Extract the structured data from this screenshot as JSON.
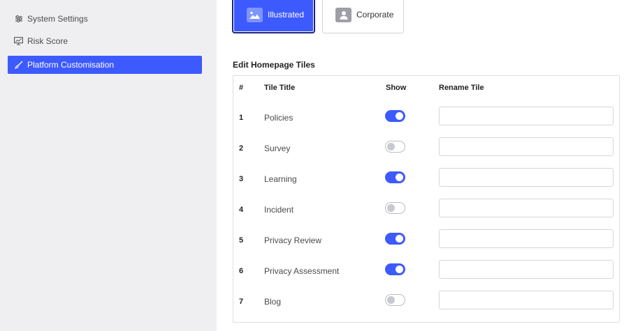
{
  "sidebar": {
    "items": [
      {
        "label": "System Settings",
        "icon": "sliders-icon",
        "active": false
      },
      {
        "label": "Risk Score",
        "icon": "monitor-chart-icon",
        "active": false
      },
      {
        "label": "Platform Customisation",
        "icon": "brush-icon",
        "active": true
      }
    ]
  },
  "themes": {
    "illustrated_label": "Illustrated",
    "corporate_label": "Corporate",
    "selected": "Illustrated"
  },
  "tiles_section": {
    "title": "Edit Homepage Tiles",
    "headers": {
      "num": "#",
      "title": "Tile Title",
      "show": "Show",
      "rename": "Rename Tile"
    },
    "rows": [
      {
        "num": "1",
        "title": "Policies",
        "show": true,
        "rename": ""
      },
      {
        "num": "2",
        "title": "Survey",
        "show": false,
        "rename": ""
      },
      {
        "num": "3",
        "title": "Learning",
        "show": true,
        "rename": ""
      },
      {
        "num": "4",
        "title": "Incident",
        "show": false,
        "rename": ""
      },
      {
        "num": "5",
        "title": "Privacy Review",
        "show": true,
        "rename": ""
      },
      {
        "num": "6",
        "title": "Privacy Assessment",
        "show": true,
        "rename": ""
      },
      {
        "num": "7",
        "title": "Blog",
        "show": false,
        "rename": ""
      }
    ]
  },
  "colors": {
    "accent": "#3d5afe",
    "sidebar_bg": "#efeff1"
  }
}
